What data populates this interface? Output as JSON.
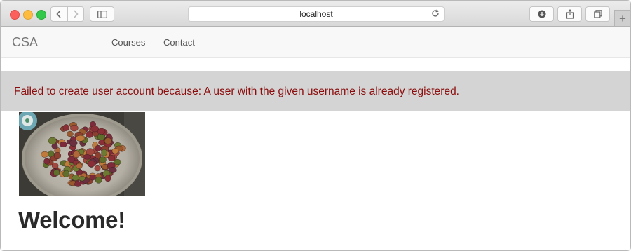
{
  "browser": {
    "url": "localhost",
    "icons": [
      "back-icon",
      "forward-icon",
      "sidebar-icon",
      "reload-icon",
      "download-icon",
      "share-icon",
      "tabs-icon",
      "plus-icon"
    ],
    "new_tab_label": "+"
  },
  "navbar": {
    "brand": "CSA",
    "links": [
      "Courses",
      "Contact"
    ]
  },
  "alert": {
    "message": "Failed to create user account because: A user with the given username is already registered.",
    "text_color": "#8b0d0d",
    "background": "#d4d4d4"
  },
  "hero": {
    "image": "basket-of-fruit-photo",
    "heading": "Welcome!"
  }
}
